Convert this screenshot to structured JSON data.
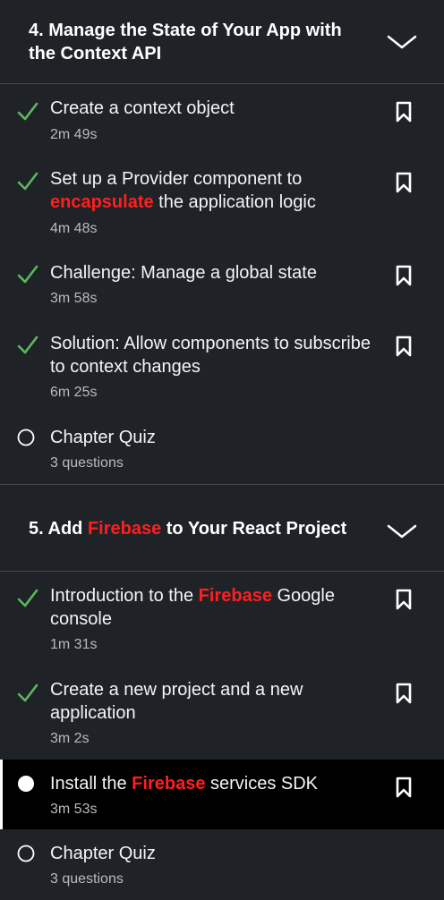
{
  "chapters": [
    {
      "title": "4. Manage the State of Your App with the Context API",
      "items": [
        {
          "title": "Create a context object",
          "duration": "2m 49s",
          "status": "done"
        },
        {
          "title_parts": [
            "Set up a Provider component to ",
            "encapsulate",
            " the application logic"
          ],
          "duration": "4m 48s",
          "status": "done"
        },
        {
          "title": "Challenge: Manage a global state",
          "duration": "3m 58s",
          "status": "done"
        },
        {
          "title": "Solution: Allow components to subscribe to context changes",
          "duration": "6m 25s",
          "status": "done"
        },
        {
          "title": "Chapter Quiz",
          "duration": "3 questions",
          "status": "not-started"
        }
      ]
    },
    {
      "title_parts": [
        "5. Add ",
        "Firebase",
        " to Your React Project"
      ],
      "items": [
        {
          "title_parts": [
            "Introduction to the ",
            "Firebase",
            " Google console"
          ],
          "duration": "1m 31s",
          "status": "done"
        },
        {
          "title": "Create a new project and a new application",
          "duration": "3m 2s",
          "status": "done"
        },
        {
          "title_parts": [
            "Install the ",
            "Firebase",
            " services SDK"
          ],
          "duration": "3m 53s",
          "status": "current"
        },
        {
          "title": "Chapter Quiz",
          "duration": "3 questions",
          "status": "not-started"
        }
      ]
    }
  ],
  "colors": {
    "background": "#1f2328",
    "active_background": "#000000",
    "check": "#5cb85c",
    "highlight": "#ff1f1f"
  },
  "icons": {
    "done": "checkmark-icon",
    "not_started": "empty-circle-icon",
    "current": "filled-circle-icon",
    "bookmark": "bookmark-icon",
    "collapse": "chevron-down-icon"
  }
}
